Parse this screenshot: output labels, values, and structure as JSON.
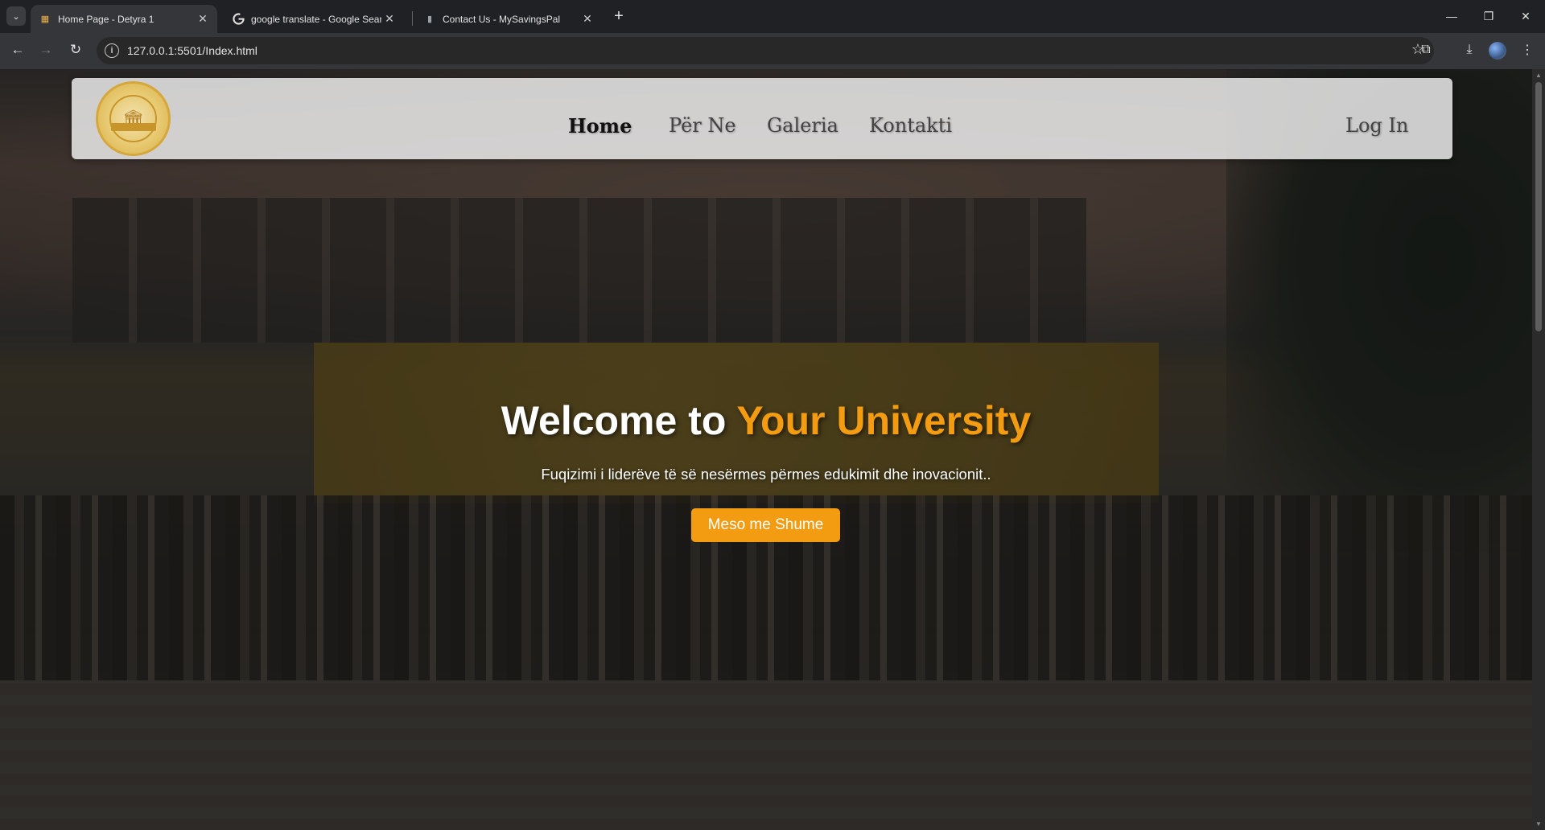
{
  "browser": {
    "tabs": [
      {
        "title": "Home Page - Detyra 1",
        "favicon": "site-icon",
        "active": true
      },
      {
        "title": "google translate - Google Search",
        "favicon": "google-icon",
        "active": false
      },
      {
        "title": "Contact Us - MySavingsPal",
        "favicon": "site-icon",
        "active": false
      }
    ],
    "url": "127.0.0.1:5501/Index.html"
  },
  "site": {
    "logo_icon": "university-seal-icon",
    "nav": {
      "home": "Home",
      "about": "Për Ne",
      "gallery": "Galeria",
      "contact": "Kontakti",
      "login": "Log In"
    },
    "hero": {
      "title_prefix": "Welcome to ",
      "title_accent": "Your University",
      "subtitle": "Fuqizimi i liderëve të së nesërmes përmes edukimit dhe inovacionit..",
      "cta_label": "Meso me Shume"
    },
    "colors": {
      "accent": "#f39c12",
      "navbar_bg": "#ececec"
    }
  }
}
